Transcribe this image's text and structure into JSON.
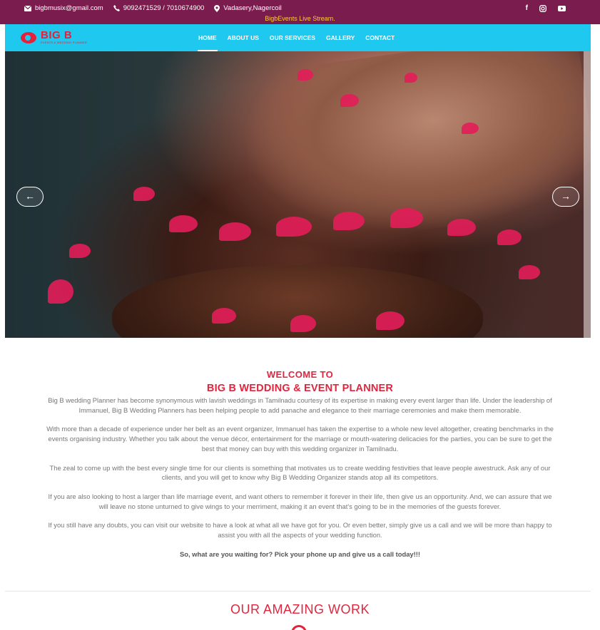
{
  "topbar": {
    "email": "bigbmusix@gmail.com",
    "phone": "9092471529 / 7010674900",
    "location": "Vadasery,Nagercoil",
    "live": "BigbEvents Live Stream.",
    "social": [
      "facebook-icon",
      "instagram-icon",
      "youtube-icon"
    ]
  },
  "logo": {
    "text": "BIG B",
    "tagline": "EVENTS & WEDDING PLANNER"
  },
  "nav": {
    "items": [
      {
        "label": "HOME",
        "active": true
      },
      {
        "label": "ABOUT US"
      },
      {
        "label": "OUR SERVICES"
      },
      {
        "label": "GALLERY"
      },
      {
        "label": "CONTACT"
      }
    ]
  },
  "hero": {
    "prev": "←",
    "next": "→"
  },
  "welcome": {
    "line1": "WELCOME TO",
    "line2": "BIG B WEDDING & EVENT PLANNER",
    "paragraphs": [
      "Big B wedding Planner has become synonymous with lavish weddings in Tamilnadu courtesy of its expertise in making every event larger than life. Under the leadership of Immanuel, Big B Wedding Planners has been helping people to add panache and elegance to their marriage ceremonies and make them memorable.",
      "With more than a decade of experience under her belt as an event organizer, Immanuel has taken the expertise to a whole new level altogether, creating benchmarks in the events organising industry. Whether you talk about the venue décor, entertainment for the marriage or mouth-watering delicacies for the parties, you can be sure to get the best that money can buy with this wedding organizer in Tamilnadu.",
      "The zeal to come up with the best every single time for our clients is something that motivates us to create wedding festivities that leave people awestruck. Ask any of our clients, and you will get to know why Big B Wedding Organizer stands atop all its competitors.",
      "If you are also looking to host a larger than life marriage event, and want others to remember it forever in their life, then give us an opportunity. And, we can assure that we will leave no stone unturned to give wings to your merriment, making it an event that's going to be in the memories of the guests forever.",
      "If you still have any doubts, you can visit our website to have a look at what all we have got for you. Or even better, simply give us a call and we will be more than happy to assist you with all the aspects of your wedding function."
    ],
    "cta": "So, what are you waiting for? Pick your phone up and give us a call today!!!"
  },
  "work": {
    "title": "OUR AMAZING WORK"
  },
  "colors": {
    "topbar": "#7a1d4e",
    "nav": "#1ec8ee",
    "accent": "#e0263f",
    "live": "#ffc83d"
  }
}
